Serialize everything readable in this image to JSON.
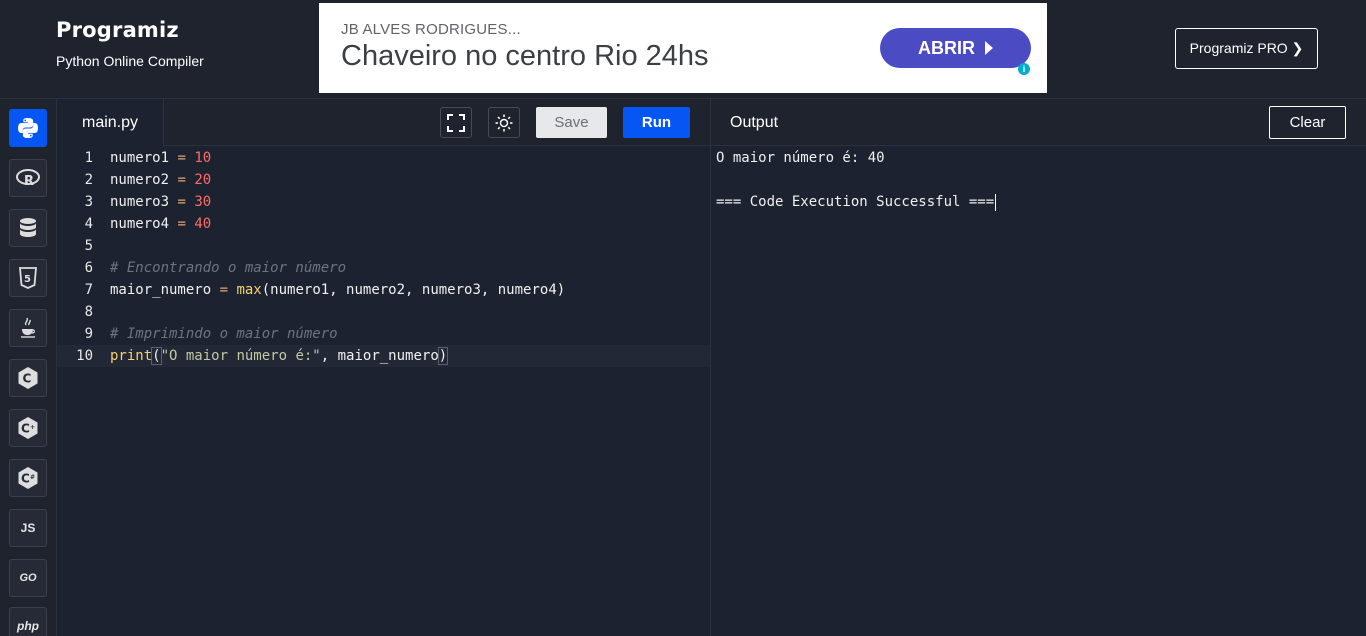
{
  "header": {
    "brand": "Programiz",
    "subtitle": "Python Online Compiler",
    "pro_button": "Programiz PRO ❯"
  },
  "ad": {
    "advertiser": "JB ALVES RODRIGUES...",
    "headline": "Chaveiro no centro Rio 24hs",
    "cta": "ABRIR",
    "info": "i"
  },
  "sidebar": {
    "items": [
      {
        "name": "python",
        "icon": "python-icon",
        "active": true
      },
      {
        "name": "r",
        "icon": "r-icon"
      },
      {
        "name": "sql",
        "icon": "database-icon"
      },
      {
        "name": "html",
        "icon": "html5-icon"
      },
      {
        "name": "java",
        "icon": "java-icon"
      },
      {
        "name": "c",
        "icon": "c-icon"
      },
      {
        "name": "cpp",
        "icon": "cpp-icon"
      },
      {
        "name": "csharp",
        "icon": "csharp-icon"
      },
      {
        "name": "javascript",
        "label": "JS"
      },
      {
        "name": "go",
        "label": "GO"
      },
      {
        "name": "php",
        "label": "php"
      }
    ]
  },
  "editor": {
    "tab": "main.py",
    "save_label": "Save",
    "run_label": "Run",
    "lines": [
      {
        "n": "1",
        "v1": "numero1",
        "op": " = ",
        "v2": "10"
      },
      {
        "n": "2",
        "v1": "numero2",
        "op": " = ",
        "v2": "20"
      },
      {
        "n": "3",
        "v1": "numero3",
        "op": " = ",
        "v2": "30"
      },
      {
        "n": "4",
        "v1": "numero4",
        "op": " = ",
        "v2": "40"
      },
      {
        "n": "5"
      },
      {
        "n": "6",
        "comment": "# Encontrando o maior número"
      },
      {
        "n": "7",
        "a": "maior_numero",
        "op": " = ",
        "fn": "max",
        "rest": "(numero1, numero2, numero3, numero4)"
      },
      {
        "n": "8"
      },
      {
        "n": "9",
        "comment": "# Imprimindo o maior número"
      },
      {
        "n": "10",
        "fn": "print",
        "open": "(",
        "str": "\"O maior número é:\"",
        "rest": ", maior_numero",
        "close": ")"
      }
    ]
  },
  "output": {
    "title": "Output",
    "clear_label": "Clear",
    "lines": [
      "O maior número é: 40",
      "",
      "=== Code Execution Successful ==="
    ]
  }
}
